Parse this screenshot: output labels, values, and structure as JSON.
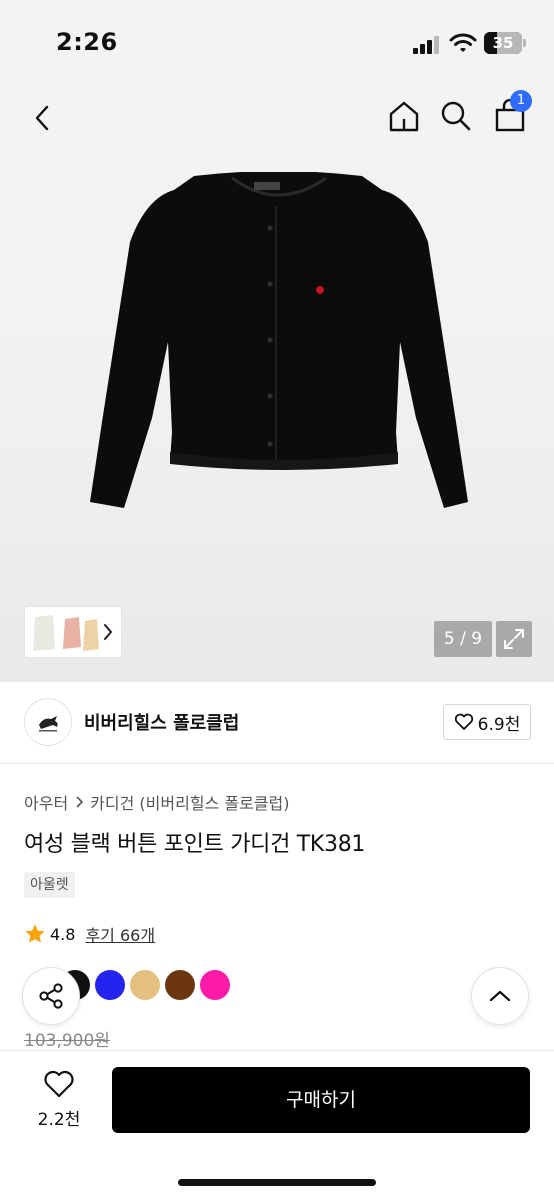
{
  "status_bar": {
    "time": "2:26",
    "battery": "35"
  },
  "header": {
    "cart_count": "1"
  },
  "gallery": {
    "counter": "5 / 9"
  },
  "brand": {
    "name": "비버리힐스 폴로클럽",
    "likes": "6.9천"
  },
  "breadcrumb": {
    "category": "아우터",
    "subcategory": "카디건 (비버리힐스 폴로클럽)"
  },
  "product": {
    "title": "여성 블랙 버튼 포인트 가디건 TK381",
    "tag": "아울렛",
    "rating": "4.8",
    "review_link": "후기 66개",
    "original_price": "103,900원"
  },
  "colors": [
    "#111111",
    "#2424ee",
    "#e3bf80",
    "#6b3610",
    "#ff1aa8"
  ],
  "bottom_bar": {
    "wish_count": "2.2천",
    "buy_label": "구매하기"
  }
}
